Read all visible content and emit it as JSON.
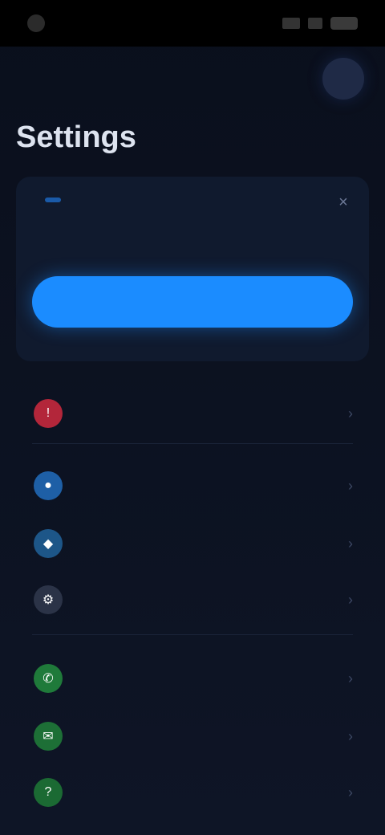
{
  "status_bar": {
    "time": "",
    "battery": ""
  },
  "header": {
    "title": "Settings"
  },
  "promo_card": {
    "label": "",
    "badge": "",
    "text": "",
    "button_label": "",
    "footnote": ""
  },
  "menu": {
    "group1": [
      {
        "label": "",
        "icon": "alert-icon"
      },
      {
        "label": "",
        "icon": "account-icon"
      },
      {
        "label": "",
        "icon": "shield-icon"
      },
      {
        "label": "",
        "icon": "gear-icon"
      }
    ],
    "group2": [
      {
        "label": "",
        "icon": "phone-icon"
      },
      {
        "label": "",
        "icon": "chat-icon"
      },
      {
        "label": "",
        "icon": "help-icon"
      }
    ]
  },
  "colors": {
    "accent": "#1b8cff",
    "background": "#0e1526",
    "card": "#101a2e"
  }
}
